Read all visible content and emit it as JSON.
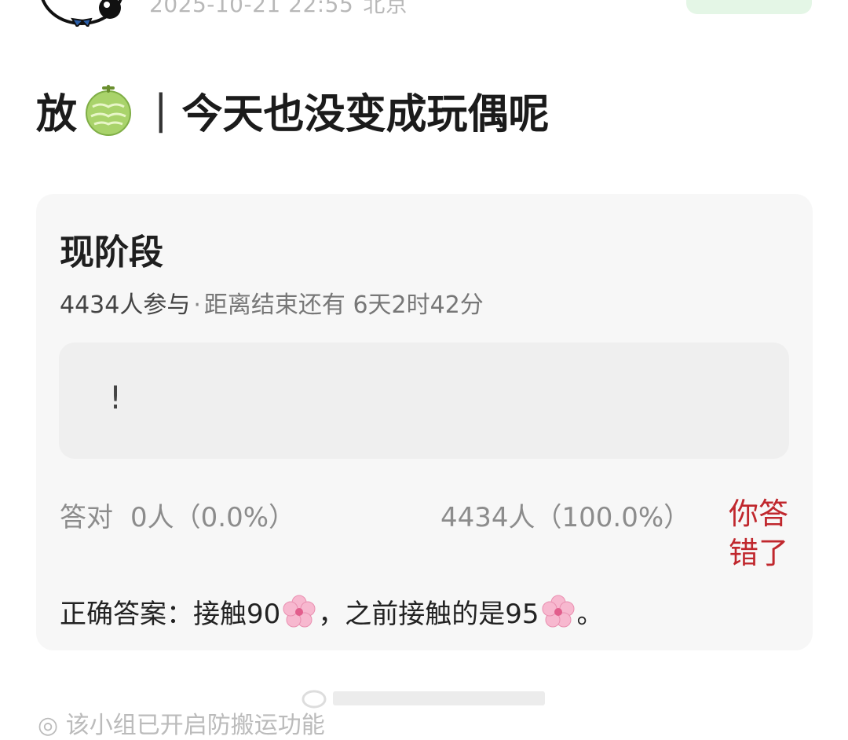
{
  "post": {
    "datetime": "2025-10-21 22:55",
    "location": "北京",
    "title_prefix": "放",
    "title_separator": "|",
    "title_text": "今天也没变成玩偶呢"
  },
  "quiz": {
    "title": "现阶段",
    "participants": "4434人参与",
    "dot": "·",
    "deadline": "距离结束还有 6天2时42分",
    "option_text": "!",
    "correct_label": "答对",
    "correct_stat": "0人（0.0%）",
    "wrong_stat": "4434人（100.0%）",
    "wrong_badge": "你答错了",
    "answer_part1": "正确答案：接触90",
    "answer_part2": "，之前接触的是95",
    "answer_part3": "。"
  },
  "footer": {
    "text": "◎ 该小组已开启防搬运功能"
  },
  "icons": {
    "avatar": "cartoon-avatar-icon",
    "melon": "melon-emoji-icon",
    "flower": "cherry-blossom-emoji-icon"
  },
  "colors": {
    "wrong": "#c0272d",
    "follow_bg": "#e4f6e6",
    "card_bg": "#f7f7f7"
  }
}
